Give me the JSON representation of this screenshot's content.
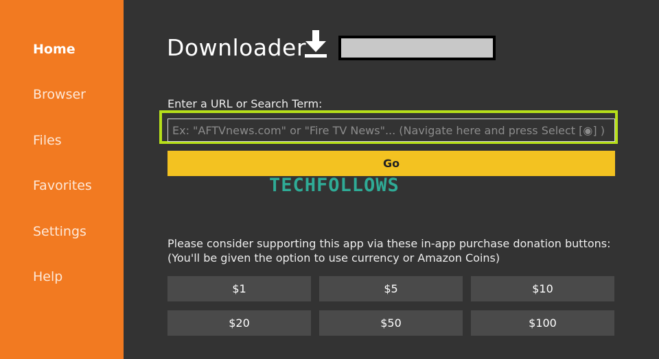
{
  "sidebar": {
    "items": [
      {
        "label": "Home",
        "active": true
      },
      {
        "label": "Browser"
      },
      {
        "label": "Files"
      },
      {
        "label": "Favorites"
      },
      {
        "label": "Settings"
      },
      {
        "label": "Help"
      }
    ]
  },
  "header": {
    "title": "Downloader",
    "icon": "download-icon"
  },
  "search": {
    "label": "Enter a URL or Search Term:",
    "placeholder": "Ex: \"AFTVnews.com\" or \"Fire TV News\"... (Navigate here and press Select [◉] )",
    "value": ""
  },
  "go_button": {
    "label": "Go"
  },
  "watermark": "TECHFOLLOWS",
  "donation": {
    "line1": "Please consider supporting this app via these in-app purchase donation buttons:",
    "line2": "(You'll be given the option to use currency or Amazon Coins)",
    "buttons": [
      "$1",
      "$5",
      "$10",
      "$20",
      "$50",
      "$100"
    ]
  },
  "colors": {
    "sidebar": "#f27a21",
    "background": "#333333",
    "go_button": "#f3c221",
    "highlight": "#b7e01a",
    "donate_button": "#4a4a4a"
  }
}
